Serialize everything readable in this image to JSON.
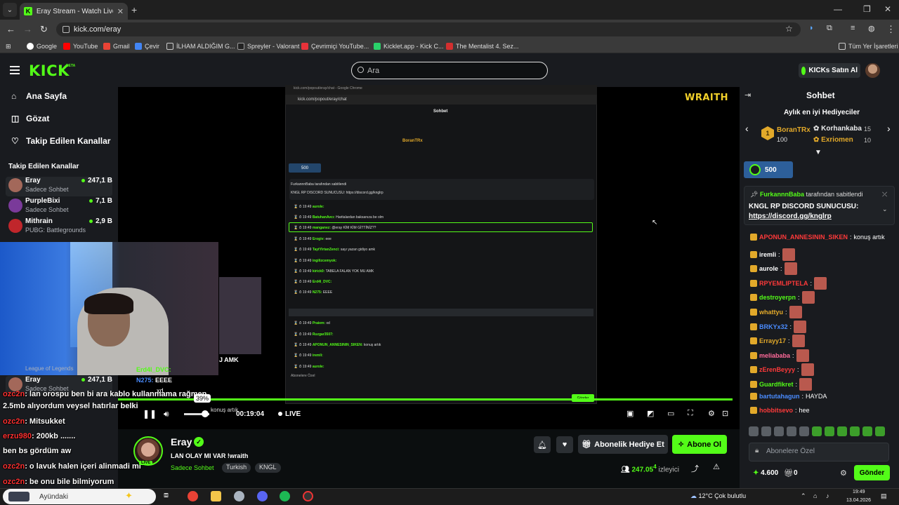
{
  "browser": {
    "tab_title": "Eray Stream - Watch Live o",
    "url": "kick.com/eray",
    "bookmarks": [
      "Google",
      "YouTube",
      "Gmail",
      "Çevir",
      "İLHAM ALDIĞIM G...",
      "Spreyler - Valorant",
      "Çevrimiçi YouTube...",
      "Kicklet.app - Kick C...",
      "The Mentalist 4. Sez..."
    ],
    "all_bookmarks": "Tüm Yer İşaretleri"
  },
  "header": {
    "logo": "KICK",
    "beta": "BETA",
    "search_placeholder": "Ara",
    "kicks_button": "KICKs Satın Al"
  },
  "sidebar": {
    "nav": [
      "Ana Sayfa",
      "Gözat",
      "Takip Edilen Kanallar"
    ],
    "followed_title": "Takip Edilen Kanallar",
    "channels": [
      {
        "name": "Eray",
        "category": "Sadece Sohbet",
        "viewers": "247,1 B"
      },
      {
        "name": "PurpleBixi",
        "category": "Sadece Sohbet",
        "viewers": "7,1 B"
      },
      {
        "name": "Mithrain",
        "category": "PUBG: Battlegrounds",
        "viewers": "2,9 B"
      }
    ]
  },
  "popout": {
    "window_title": "kick.com/popout/eray/chat - Google Chrome",
    "url": "kick.com/popout/eray/chat",
    "header": "Sohbet",
    "goal": "500",
    "pinned_by": "FurkannnBaba tarafından sabitlendi",
    "pinned_text": "KNGL RP DISCORD SUNUCUSU: https://discord.gg/knglrp",
    "lines": [
      {
        "user": "aurole:",
        "text": ""
      },
      {
        "user": "BatuhanAvcı:",
        "text": "Haritalardan baksanıza be olm"
      },
      {
        "user": "manganez:",
        "text": "@eray KİM KİM GİTTİNİZ??"
      },
      {
        "user": "Erogiv:",
        "text": "eee"
      },
      {
        "user": "TaytYirtanZenci:",
        "text": "sayı yazan gidiyo amk"
      },
      {
        "user": "ingilizcemyok:",
        "text": ""
      },
      {
        "user": "kirick0:",
        "text": "TABELA FALAN YOK MU AMK"
      },
      {
        "user": "Erd4l_DVC:",
        "text": ""
      },
      {
        "user": "N275:",
        "text": "EEEE"
      },
      {
        "user": "Praiem:",
        "text": "xd"
      },
      {
        "user": "Ruzgar3507:",
        "text": ""
      },
      {
        "user": "APONUN_ANNESININ_SIKEN:",
        "text": "konuş artık"
      },
      {
        "user": "iremli:",
        "text": ""
      },
      {
        "user": "aurole:",
        "text": ""
      }
    ],
    "footer": "Abonelere Özel",
    "send": "Gönder"
  },
  "video_logo": "WRAITH",
  "overlay_chat": [
    {
      "user": "ozc2n",
      "text": ": lan orospu ben bi ara kablo kullanmama rağmen"
    },
    {
      "user": "",
      "text": "2.5mb alıyordum veysel hatırlar belki"
    },
    {
      "user": "ozc2n",
      "text": ": Mitsukket"
    },
    {
      "user": "erzu980",
      "text": ": 200kb ......."
    },
    {
      "user": "",
      "text": "ben bs gördüm aw"
    },
    {
      "user": "ozc2n",
      "text": ": o lavuk halen içeri alinmadi mi"
    },
    {
      "user": "ozc2n",
      "text": ": be onu bile bilmiyorum"
    }
  ],
  "overlay_popout": [
    {
      "user": "Erd4l_DVC:",
      "text": ""
    },
    {
      "user": "N275:",
      "text": "EEEE"
    },
    {
      "user": "Praiem:",
      "text": "xd"
    },
    {
      "user": "",
      "text": "J AMK"
    },
    {
      "user": "",
      "text": "konuş artık"
    }
  ],
  "player": {
    "time": "00:19:04",
    "live": "LIVE",
    "volume": "39%",
    "volume_fraction": 0.39
  },
  "stream": {
    "name": "Eray",
    "title": "LAN OLAY MI VAR !wraith",
    "category": "Sadece Sohbet",
    "tags": [
      "Turkish",
      "KNGL"
    ],
    "live_badge": "LIVE",
    "gift_sub": "Abonelik Hediye Et",
    "subscribe": "Abone Ol",
    "viewers": "247.05",
    "viewers_sup": "4",
    "viewers_label": "izleyici"
  },
  "chat": {
    "title": "Sohbet",
    "gifters_title": "Aylık en iyi Hediyeciler",
    "top_gifter": {
      "rank": "1",
      "name": "BoranTRx",
      "count": "100"
    },
    "gifters": [
      {
        "name": "Korhankaba",
        "count": "15",
        "color": "#ffffff"
      },
      {
        "name": "Exriomen",
        "count": "10",
        "color": "#e2a92a"
      }
    ],
    "goal": "500",
    "pinned_by": "FurkannnBaba",
    "pinned_suffix": "tarafından sabitlendi",
    "pinned_text": "KNGL RP DISCORD SUNUCUSU:",
    "pinned_link": "https://discord.gg/knglrp",
    "messages": [
      {
        "user": "APONUN_ANNESININ_SIKEN",
        "text": "konuş artık",
        "color": "#ff3a3a",
        "emote": false
      },
      {
        "user": "iremli",
        "text": "",
        "color": "#ffffff",
        "emote": true
      },
      {
        "user": "aurole",
        "text": "",
        "color": "#ffffff",
        "emote": true
      },
      {
        "user": "RPYEMLIPTELA",
        "text": "",
        "color": "#ff3a3a",
        "emote": true
      },
      {
        "user": "destroyerpn",
        "text": "",
        "color": "#53fc18",
        "emote": true
      },
      {
        "user": "whattyu",
        "text": "",
        "color": "#e2a92a",
        "emote": true
      },
      {
        "user": "BRKYx32",
        "text": "",
        "color": "#4a8cff",
        "emote": true
      },
      {
        "user": "Errayy17",
        "text": "",
        "color": "#e2a92a",
        "emote": true
      },
      {
        "user": "meliababa",
        "text": "",
        "color": "#ff6a9a",
        "emote": true
      },
      {
        "user": "zErenBeyyy",
        "text": "",
        "color": "#ff3a3a",
        "emote": true
      },
      {
        "user": "Guardfikret",
        "text": "",
        "color": "#53fc18",
        "emote": true
      },
      {
        "user": "bartutahagun",
        "text": "HAYDA",
        "color": "#4a8cff",
        "emote": false
      },
      {
        "user": "hobbitsevo",
        "text": "hee",
        "color": "#ff3a3a",
        "emote": false
      }
    ],
    "input_placeholder": "Abonelere Özel",
    "points": "4.600",
    "gifts": "0",
    "send": "Gönder"
  },
  "taskbar": {
    "search": "Ayündaki",
    "weather": "12°C  Çok bulutlu",
    "time": "19:49",
    "date": "13.04.2026"
  }
}
